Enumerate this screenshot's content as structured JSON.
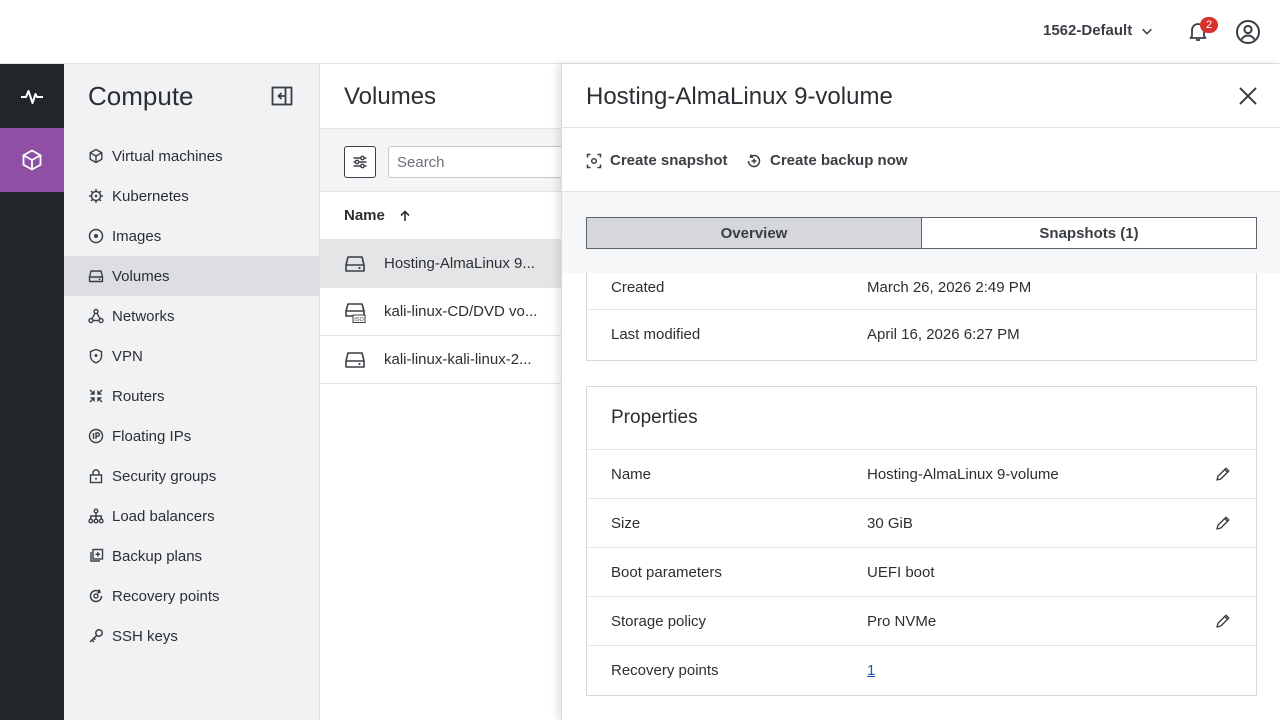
{
  "header": {
    "project": "1562-Default",
    "notifications_count": "2"
  },
  "sidebar": {
    "title": "Compute",
    "items": [
      {
        "label": "Virtual machines",
        "icon": "cube-icon"
      },
      {
        "label": "Kubernetes",
        "icon": "kubernetes-icon"
      },
      {
        "label": "Images",
        "icon": "disc-icon"
      },
      {
        "label": "Volumes",
        "icon": "drive-icon",
        "active": true
      },
      {
        "label": "Networks",
        "icon": "network-icon"
      },
      {
        "label": "VPN",
        "icon": "shield-icon"
      },
      {
        "label": "Routers",
        "icon": "router-icon"
      },
      {
        "label": "Floating IPs",
        "icon": "ip-icon"
      },
      {
        "label": "Security groups",
        "icon": "lock-icon"
      },
      {
        "label": "Load balancers",
        "icon": "hierarchy-icon"
      },
      {
        "label": "Backup plans",
        "icon": "backup-icon"
      },
      {
        "label": "Recovery points",
        "icon": "recovery-icon"
      },
      {
        "label": "SSH keys",
        "icon": "key-icon"
      }
    ]
  },
  "main": {
    "title": "Volumes",
    "search_placeholder": "Search",
    "column_name": "Name",
    "rows": [
      {
        "name": "Hosting-AlmaLinux 9...",
        "icon": "drive-icon",
        "active": true
      },
      {
        "name": "kali-linux-CD/DVD vo...",
        "icon": "iso-drive-icon"
      },
      {
        "name": "kali-linux-kali-linux-2...",
        "icon": "drive-icon"
      }
    ]
  },
  "drawer": {
    "title": "Hosting-AlmaLinux 9-volume",
    "actions": {
      "snapshot": "Create snapshot",
      "backup": "Create backup now"
    },
    "tabs": {
      "overview": "Overview",
      "snapshots": "Snapshots (1)"
    },
    "info": {
      "created_label": "Created",
      "created_value": "March 26, 2026 2:49 PM",
      "modified_label": "Last modified",
      "modified_value": "April 16, 2026 6:27 PM"
    },
    "properties": {
      "title": "Properties",
      "name_label": "Name",
      "name_value": "Hosting-AlmaLinux 9-volume",
      "size_label": "Size",
      "size_value": "30 GiB",
      "boot_label": "Boot parameters",
      "boot_value": "UEFI boot",
      "storage_label": "Storage policy",
      "storage_value": "Pro NVMe",
      "recovery_label": "Recovery points",
      "recovery_value": "1"
    }
  },
  "colors": {
    "accent": "#8e4fa4",
    "rail": "#232629",
    "badge": "#d9312b",
    "link": "#1f57a8"
  }
}
